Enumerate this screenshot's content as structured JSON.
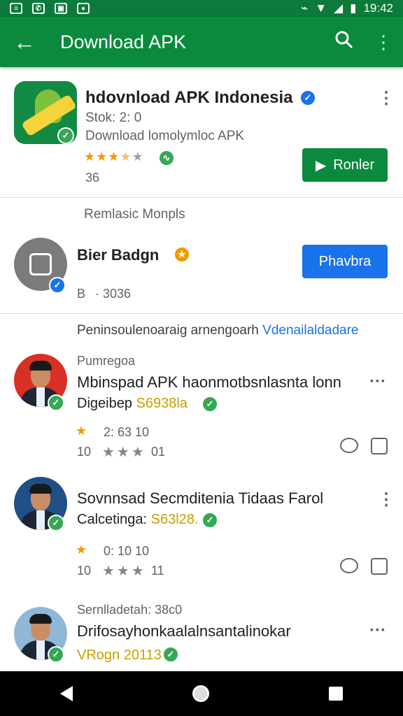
{
  "status_bar": {
    "time": "19:42"
  },
  "app_bar": {
    "title": "Download APK",
    "back_icon": "arrow-left-icon",
    "search_icon": "search-icon",
    "more_icon": "more-vert-icon"
  },
  "app_card": {
    "name": "hdovnload APK Indonesia",
    "line1": "Stok: 2: 0",
    "line2": "Download lomolymloc APK",
    "rating_count": "36",
    "button_label": "Ronler",
    "colors": {
      "button": "#0b8a3e"
    }
  },
  "section_header": "Remlasic Monpls",
  "developer": {
    "name": "Bier Badgn",
    "meta_left": "B",
    "meta_right": "· 3036",
    "button_label": "Phavbra",
    "colors": {
      "button": "#1a73e8"
    }
  },
  "feed_header": {
    "text": "Peninsoulenoaraig arnengoarh",
    "link": "Vdenailaldadare"
  },
  "feed": [
    {
      "label": "Pumregoa",
      "title": "Mbinspad APK haonmotbsnlasnta lonn",
      "subtitle": "Digeibep",
      "subtitle_highlight": "S6938la",
      "stats_row1": "2:   63   10",
      "stats_row2_left": "10",
      "stats_row2_right": "01"
    },
    {
      "label": "",
      "title": "Sovnnsad Secmditenia Tidaas Farol",
      "subtitle": "Calcetinga:",
      "subtitle_highlight": "S63l28.",
      "stats_row1": "0:   10   10",
      "stats_row2_left": "10",
      "stats_row2_right": "11"
    },
    {
      "label": "Sernlladetah: 38c0",
      "title": "Drifosayhonkaalalnsantalinokar",
      "subtitle": "VRogn 20113",
      "subtitle_highlight": "",
      "stats_row1": "",
      "stats_row2_left": "",
      "stats_row2_right": ""
    }
  ]
}
